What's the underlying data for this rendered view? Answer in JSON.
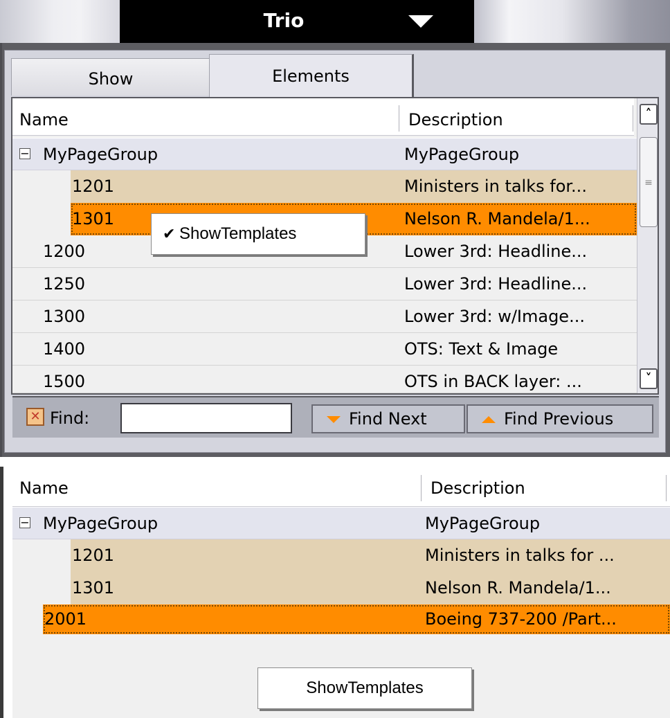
{
  "top": {
    "title": "Trio",
    "tabs": [
      {
        "label": "Show"
      },
      {
        "label": "Elements"
      }
    ],
    "columns": {
      "name": "Name",
      "description": "Description"
    },
    "rows": [
      {
        "name": "MyPageGroup",
        "description": "MyPageGroup"
      },
      {
        "name": "1201",
        "description": "Ministers in talks for..."
      },
      {
        "name": "1301",
        "description": "Nelson R. Mandela/1..."
      },
      {
        "name": "1200",
        "description": "Lower 3rd: Headline..."
      },
      {
        "name": "1250",
        "description": "Lower 3rd: Headline..."
      },
      {
        "name": "1300",
        "description": "Lower 3rd: w/Image..."
      },
      {
        "name": "1400",
        "description": "OTS: Text & Image"
      },
      {
        "name": "1500",
        "description": "OTS in BACK layer: ..."
      }
    ],
    "context_menu": {
      "item": "ShowTemplates",
      "checked": true
    },
    "find": {
      "label": "Find:",
      "value": "",
      "next": "Find Next",
      "previous": "Find Previous"
    }
  },
  "bottom": {
    "columns": {
      "name": "Name",
      "description": "Description"
    },
    "rows": [
      {
        "name": "MyPageGroup",
        "description": "MyPageGroup"
      },
      {
        "name": "1201",
        "description": "Ministers in talks for ..."
      },
      {
        "name": "1301",
        "description": "Nelson R. Mandela/1..."
      },
      {
        "name": "2001",
        "description": "Boeing 737-200 /Part..."
      }
    ],
    "context_menu": {
      "item": "ShowTemplates",
      "checked": false
    }
  },
  "colors": {
    "selection": "#ff8c00",
    "child_row": "#e3d2b3",
    "group_row": "#e3e4ee"
  }
}
